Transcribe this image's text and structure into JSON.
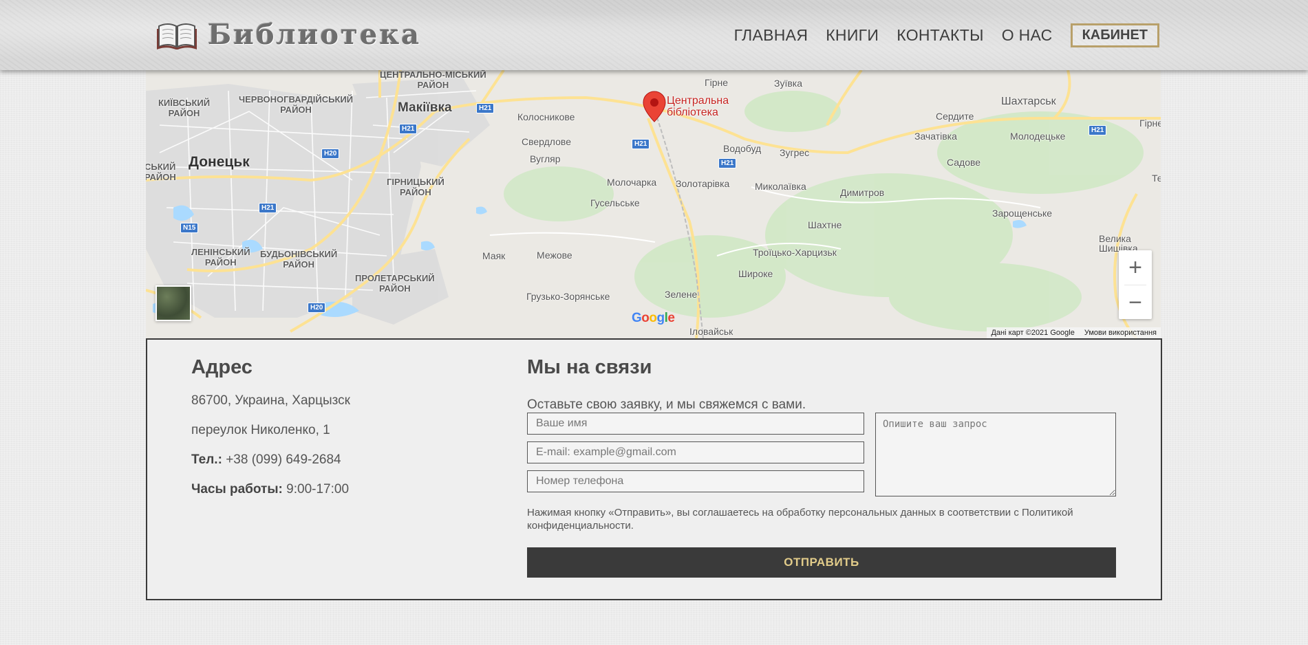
{
  "header": {
    "logo_icon": "open-book-icon",
    "logo_text": "Библиотека",
    "nav": [
      {
        "label": "ГЛАВНАЯ"
      },
      {
        "label": "КНИГИ"
      },
      {
        "label": "КОНТАКТЫ"
      },
      {
        "label": "О НАС"
      }
    ],
    "cabinet_label": "КАБИНЕТ",
    "accent_color": "#b8a06a"
  },
  "map": {
    "marker_label": "Центральна\nбібліотека",
    "marker_color": "#c5221f",
    "labels": {
      "kyivskyi": "КИЇВСЬКИЙ\nРАЙОН",
      "chervonohvardiiskyi": "ЧЕРВОНОГВАРДІЙСЬКИЙ\nРАЙОН",
      "tsentralno_miskyi": "ЦЕНТРАЛЬНО-МІСЬКИЙ\nРАЙОН",
      "makiivka": "Макіївка",
      "kolosnykove": "Колосникове",
      "sverdlove": "Свердлове",
      "vuhliar": "Вугляр",
      "hirne": "Гірне",
      "zuivka": "Зуївка",
      "serdyte": "Сердите",
      "shakhtarsk": "Шахтарськ",
      "hirne2": "Гірне",
      "zachativka": "Зачатівка",
      "molodetske": "Молодецьке",
      "vodobud": "Водобуд",
      "zuhres": "Зугрес",
      "sadove": "Садове",
      "skyi": "СЬКИЙ\nРАЙОН",
      "donetsk": "Донецьк",
      "hirnytskyi": "ГІРНИЦЬКИЙ\nРАЙОН",
      "molocharka": "Молочарка",
      "zolotarivka": "Золотарівка",
      "mykolaivka": "Миколаївка",
      "dymytrov": "Димитров",
      "husel": "Гусельське",
      "shakhtne": "Шахтне",
      "zaroshchenske": "Зарощенське",
      "te": "Те",
      "velyka": "Велика\nШишівка",
      "leninskyi": "ЛЕНІНСЬКИЙ\nРАЙОН",
      "budonivskyi": "БУДЬОНІВСЬКИЙ\nРАЙОН",
      "maiak": "Маяк",
      "mezhove": "Межове",
      "troitsko": "Троїцько-Харцизьк",
      "proletarskyi": "ПРОЛЕТАРСЬКИЙ\nРАЙОН",
      "shyroke": "Широке",
      "hruzko": "Грузько-Зорянське",
      "zelene": "Зелене",
      "ilovaisk": "Іловайськ"
    },
    "shields": {
      "h21a": "H21",
      "h21b": "H21",
      "h21c": "H21",
      "h21d": "H21",
      "h21e": "H21",
      "h21f": "H21",
      "h20a": "H20",
      "h20b": "H20",
      "n15": "N15"
    },
    "google_logo": "Google",
    "attribution_data": "Дані карт ©2021 Google",
    "attribution_terms": "Умови використання",
    "zoom_in": "+",
    "zoom_out": "−"
  },
  "address": {
    "title": "Адрес",
    "line1": "86700, Украина, Харцызск",
    "line2": "переулок Николенко, 1",
    "phone_label": "Тел.:",
    "phone_value": "+38 (099) 649-2684",
    "hours_label": "Часы работы:",
    "hours_value": "9:00-17:00"
  },
  "contact": {
    "title": "Мы на связи",
    "lead": "Оставьте свою заявку, и мы свяжемся с вами.",
    "name_placeholder": "Ваше имя",
    "email_placeholder": "E-mail: example@gmail.com",
    "phone_placeholder": "Номер телефона",
    "message_placeholder": "Опишите ваш запрос",
    "consent": "Нажимая кнопку «Отправить», вы соглашаетесь на обработку персональных данных в соответствии с Политикой конфиденциальности.",
    "submit_label": "ОТПРАВИТЬ",
    "submit_text_color": "#e2cc8a"
  }
}
